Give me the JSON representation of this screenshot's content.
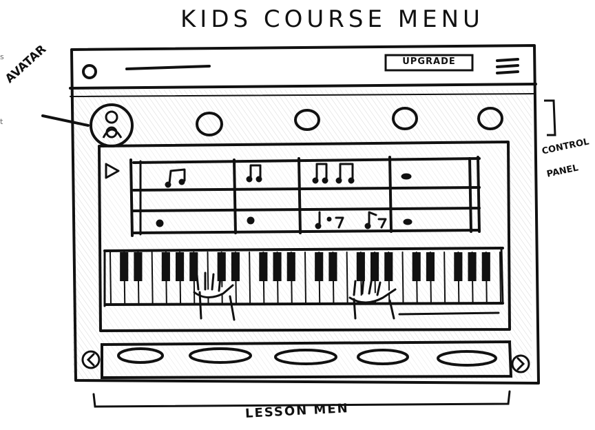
{
  "title": "KIDS COURSE MENU",
  "labels": {
    "avatar": "AVATAR",
    "control_panel": "CONTROL PANEL",
    "lesson_menu": "LESSON MEN"
  },
  "header": {
    "upgrade_label": "UPGRADE"
  },
  "edge_text": [
    "s",
    "t"
  ],
  "colors": {
    "ink": "#111111",
    "shading": "#9a9a9a"
  },
  "icons": [
    "logo-circle-icon",
    "hamburger-menu-icon",
    "play-icon",
    "left-arrow-icon",
    "right-arrow-icon"
  ]
}
